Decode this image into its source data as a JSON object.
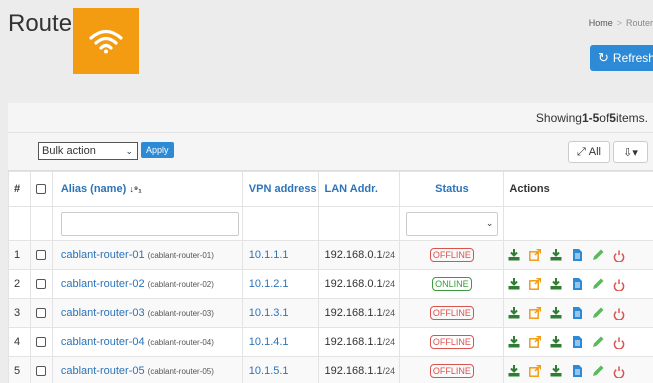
{
  "header": {
    "title": "Routers",
    "refresh_label": "Refresh"
  },
  "breadcrumb": {
    "home": "Home",
    "separator": ">",
    "current": "Router"
  },
  "summary": {
    "prefix": "Showing ",
    "range": "1-5",
    "of": " of ",
    "total": "5",
    "suffix": " items."
  },
  "toolbar": {
    "bulk_action": "Bulk action",
    "apply": "Apply",
    "all_label": "All"
  },
  "table": {
    "headers": {
      "num": "#",
      "alias": "Alias (name)",
      "vpn": "VPN address",
      "lan": "LAN Addr.",
      "status": "Status",
      "actions": "Actions"
    },
    "rows": [
      {
        "num": "1",
        "alias": "cablant-router-01",
        "name": "(cablant-router-01)",
        "vpn": "10.1.1.1",
        "lan": "192.168.0.1",
        "mask": "/24",
        "status": "OFFLINE"
      },
      {
        "num": "2",
        "alias": "cablant-router-02",
        "name": "(cablant-router-02)",
        "vpn": "10.1.2.1",
        "lan": "192.168.0.1",
        "mask": "/24",
        "status": "ONLINE"
      },
      {
        "num": "3",
        "alias": "cablant-router-03",
        "name": "(cablant-router-03)",
        "vpn": "10.1.3.1",
        "lan": "192.168.1.1",
        "mask": "/24",
        "status": "OFFLINE"
      },
      {
        "num": "4",
        "alias": "cablant-router-04",
        "name": "(cablant-router-04)",
        "vpn": "10.1.4.1",
        "lan": "192.168.1.1",
        "mask": "/24",
        "status": "OFFLINE"
      },
      {
        "num": "5",
        "alias": "cablant-router-05",
        "name": "(cablant-router-05)",
        "vpn": "10.1.5.1",
        "lan": "192.168.1.1",
        "mask": "/24",
        "status": "OFFLINE"
      }
    ]
  },
  "icons": [
    "wifi-icon",
    "refresh-icon",
    "expand-icon",
    "export-icon",
    "download-icon",
    "external-link-icon",
    "document-icon",
    "edit-icon",
    "power-icon",
    "sort-icon"
  ],
  "colors": {
    "accent": "#2c8ad6",
    "brand": "#f39c12",
    "offline": "#d9534f",
    "online": "#3c9b3c",
    "link": "#2c73b8"
  }
}
